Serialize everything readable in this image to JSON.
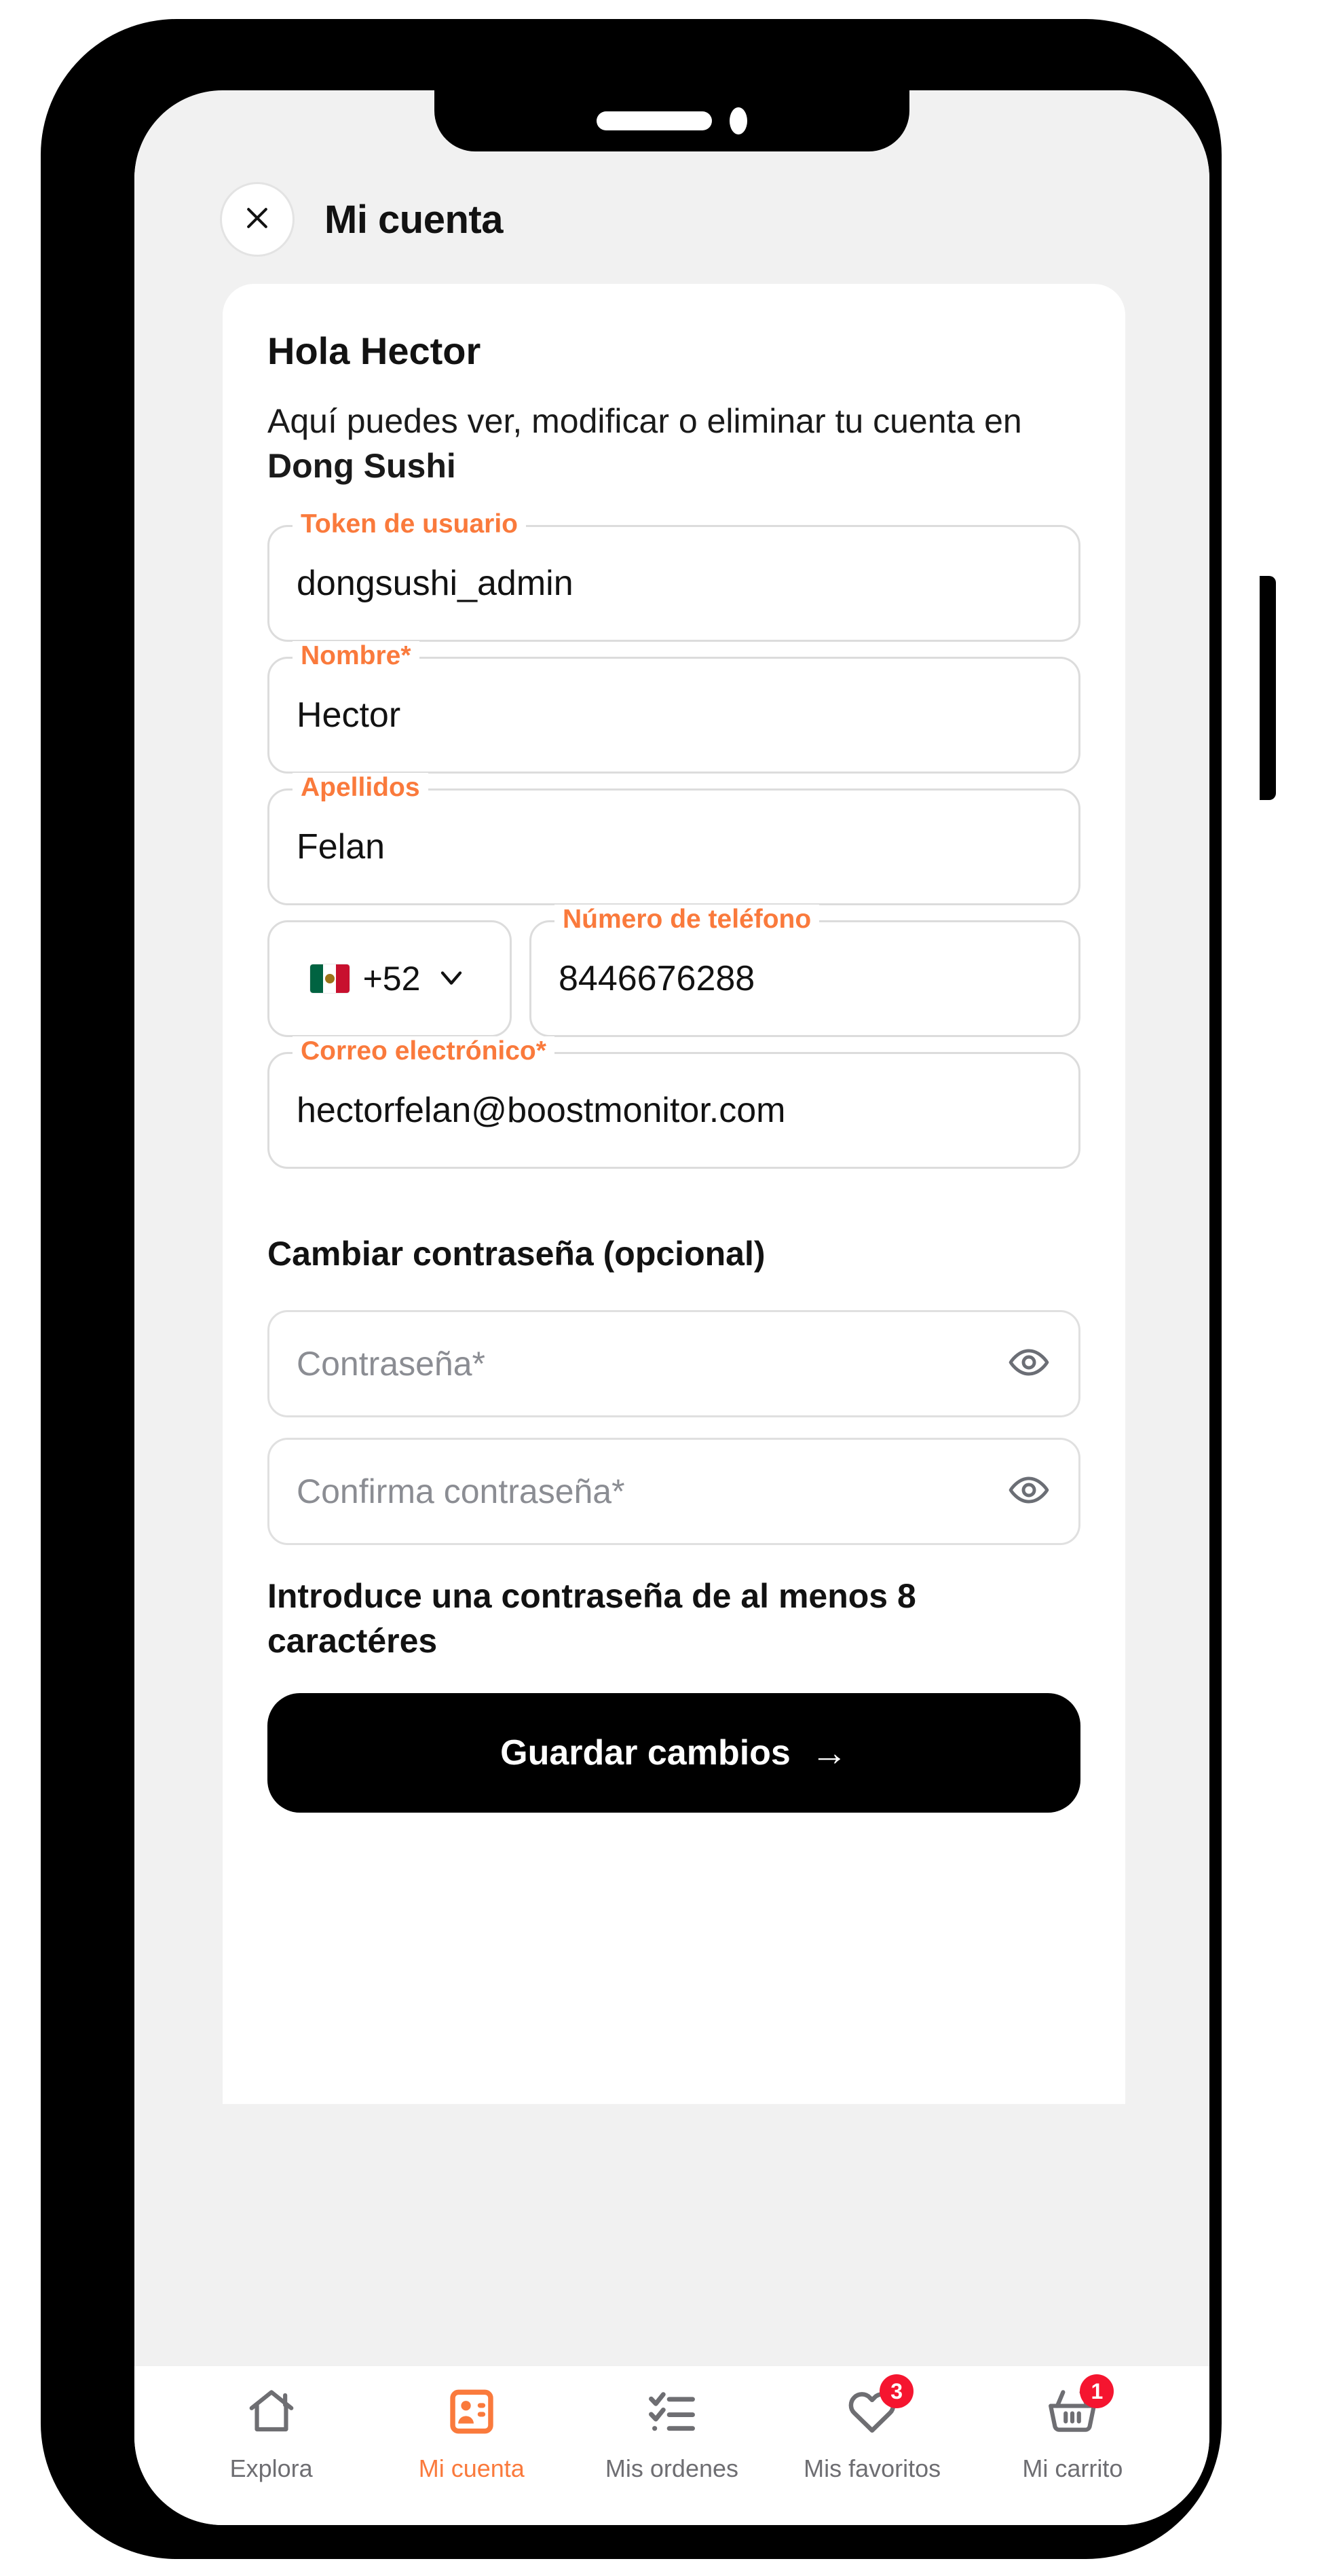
{
  "header": {
    "title": "Mi cuenta",
    "close_icon": "close-icon"
  },
  "card": {
    "greeting": "Hola Hector",
    "intro_prefix": "Aquí puedes ver, modificar o eliminar tu cuenta en ",
    "intro_brand": "Dong Sushi"
  },
  "fields": {
    "token": {
      "label": "Token de usuario",
      "value": "dongsushi_admin"
    },
    "first_name": {
      "label": "Nombre*",
      "value": "Hector"
    },
    "last_name": {
      "label": "Apellidos",
      "value": "Felan"
    },
    "country": {
      "flag": "mexico-flag-icon",
      "code": "+52",
      "chevron": "chevron-down-icon"
    },
    "phone": {
      "label": "Número de teléfono",
      "value": "8446676288"
    },
    "email": {
      "label": "Correo electrónico*",
      "value": "hectorfelan@boostmonitor.com"
    }
  },
  "password_section": {
    "heading": "Cambiar contraseña (opcional)",
    "password_placeholder": "Contraseña*",
    "confirm_placeholder": "Confirma contraseña*",
    "toggle_icon": "eye-icon",
    "hint": "Introduce una contraseña de al menos 8 caractéres"
  },
  "actions": {
    "save_label": "Guardar cambios",
    "save_arrow": "→"
  },
  "bottom_nav": [
    {
      "id": "explora",
      "label": "Explora",
      "icon": "home-icon",
      "badge": null,
      "active": false
    },
    {
      "id": "mi-cuenta",
      "label": "Mi cuenta",
      "icon": "id-card-icon",
      "badge": null,
      "active": true
    },
    {
      "id": "mis-ordenes",
      "label": "Mis ordenes",
      "icon": "checklist-icon",
      "badge": null,
      "active": false
    },
    {
      "id": "mis-favoritos",
      "label": "Mis favoritos",
      "icon": "heart-icon",
      "badge": "3",
      "active": false
    },
    {
      "id": "mi-carrito",
      "label": "Mi carrito",
      "icon": "basket-icon",
      "badge": "1",
      "active": false
    }
  ],
  "colors": {
    "accent_orange": "#FA7A3C",
    "badge_red": "#F5152F",
    "screen_bg": "#F1F1F1",
    "card_bg": "#FFFFFF",
    "text_primary": "#121212",
    "text_muted": "#6E6E72",
    "field_border": "#DCDCDC",
    "button_bg": "#000000"
  }
}
